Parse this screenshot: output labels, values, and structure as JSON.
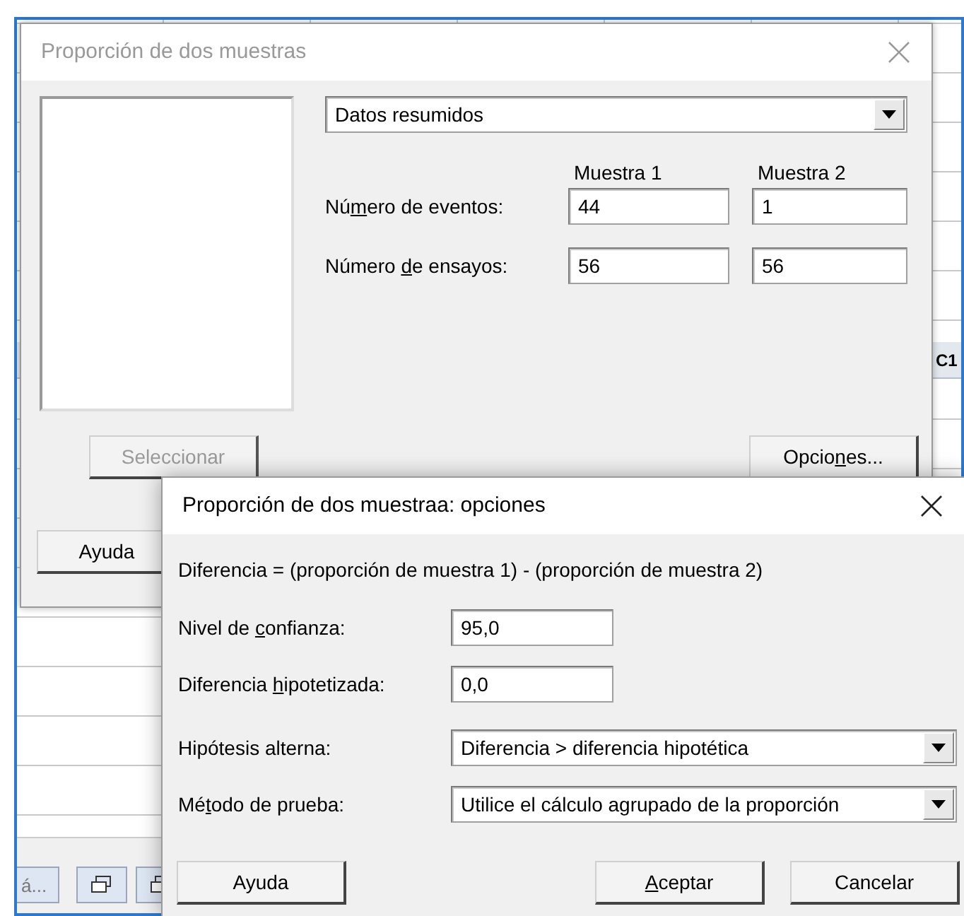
{
  "background_app": {
    "column_header": "C1",
    "sheet_tab": "á..."
  },
  "main_dialog": {
    "title": "Proporción de dos muestras",
    "active": false,
    "data_source": {
      "value": "Datos resumidos"
    },
    "column_headings": [
      "Muestra 1",
      "Muestra 2"
    ],
    "rows": [
      {
        "label": {
          "before": "Nú",
          "key": "m",
          "after": "ero de eventos:"
        },
        "values": [
          "44",
          "1"
        ]
      },
      {
        "label": {
          "before": "Número ",
          "key": "d",
          "after": "e ensayos:"
        },
        "values": [
          "56",
          "56"
        ]
      }
    ],
    "buttons": [
      {
        "label": {
          "before": "Seleccionar"
        },
        "disabled": true
      },
      {
        "label": {
          "before": "Opcio",
          "key": "n",
          "after": "es..."
        },
        "disabled": false
      },
      {
        "label": {
          "before": "Ayuda"
        },
        "disabled": false
      }
    ]
  },
  "options_dialog": {
    "title": "Proporción de dos muestraa: opciones",
    "active": true,
    "formula": "Diferencia = (proporción de muestra 1) - (proporción de muestra 2)",
    "fields": [
      {
        "kind": "text",
        "label": {
          "before": "Nivel de ",
          "key": "c",
          "after": "onfianza:"
        },
        "value": "95,0"
      },
      {
        "kind": "text",
        "label": {
          "before": "Diferencia ",
          "key": "h",
          "after": "ipotetizada:"
        },
        "value": "0,0"
      },
      {
        "kind": "select",
        "label": {
          "before": "Hipótesis alterna:"
        },
        "value": "Diferencia > diferencia hipotética"
      },
      {
        "kind": "select",
        "label": {
          "before": "Mé",
          "key": "t",
          "after": "odo de prueba:"
        },
        "value": "Utilice el cálculo agrupado de la proporción"
      }
    ],
    "buttons": [
      {
        "label": {
          "before": "Ayuda"
        },
        "disabled": false
      },
      {
        "label": {
          "key": "A",
          "after": "ceptar"
        },
        "disabled": false
      },
      {
        "label": {
          "before": "Cancelar"
        },
        "disabled": false
      }
    ]
  }
}
